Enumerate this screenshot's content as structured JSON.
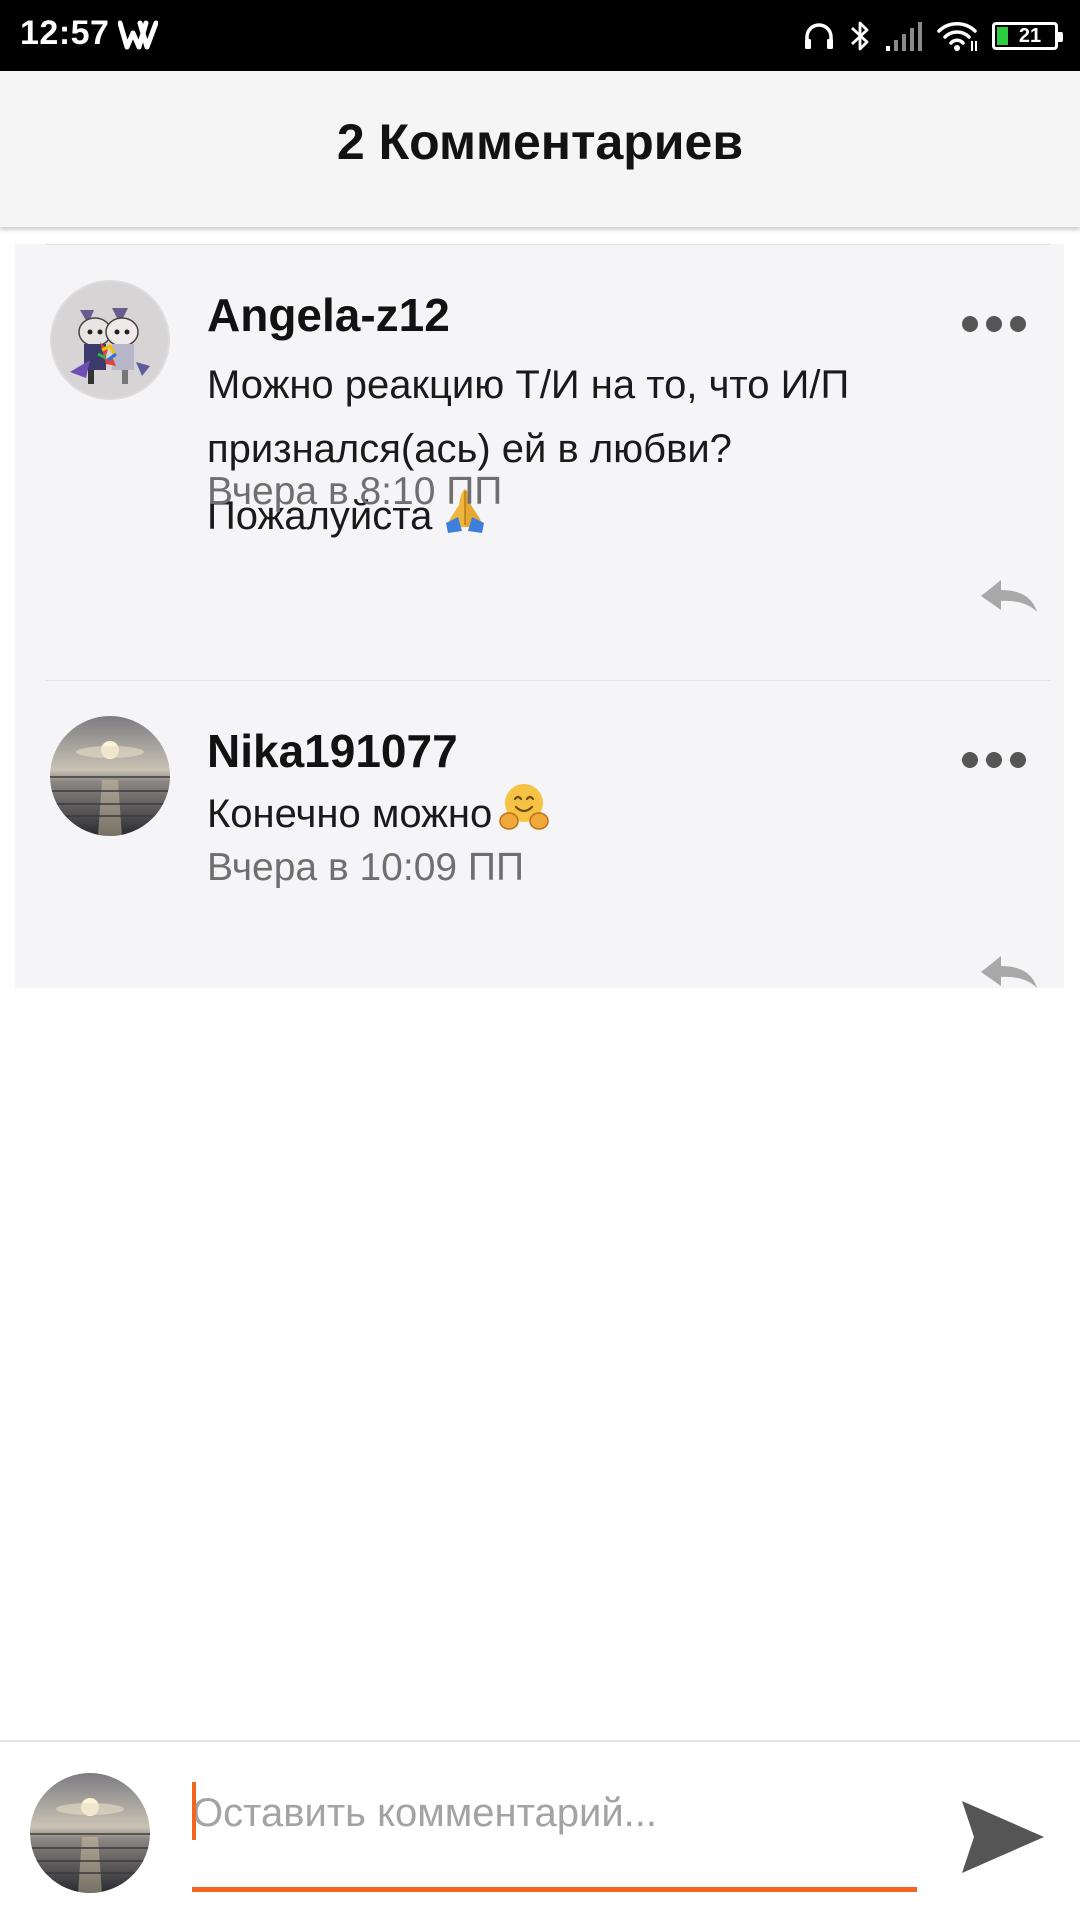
{
  "status_bar": {
    "time": "12:57",
    "battery_level": "21",
    "icons": [
      "wattpad-icon",
      "headphones-icon",
      "bluetooth-icon",
      "signal-icon",
      "wifi-icon",
      "battery-icon"
    ]
  },
  "header": {
    "title": "2 Комментариев"
  },
  "comments": [
    {
      "author": "Angela-z12",
      "text": "Можно реакцию Т/И на то, что И/П признался(ась) ей в любви? Пожалуйста",
      "emoji": "folded-hands",
      "timestamp": "Вчера в 8:10 ПП",
      "avatar": "cartoon-avatar"
    },
    {
      "author": "Nika191077",
      "text": "Конечно можно",
      "emoji": "hugging-face",
      "timestamp": "Вчера в 10:09 ПП",
      "avatar": "sunset-avatar"
    }
  ],
  "composer": {
    "placeholder": "Оставить комментарий...",
    "value": "",
    "avatar": "sunset-avatar"
  },
  "colors": {
    "accent": "#f2661d",
    "card_background": "#f5f4f7",
    "header_background": "#f5f5f5",
    "timestamp": "#6f6f6f",
    "placeholder": "#a3a3a3"
  }
}
